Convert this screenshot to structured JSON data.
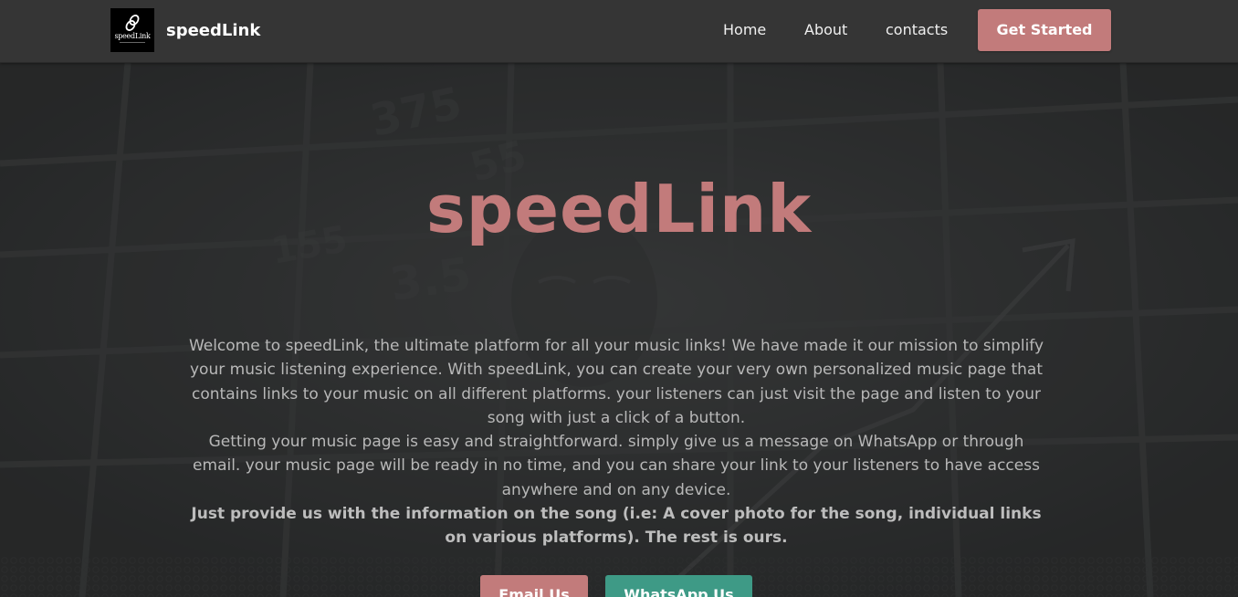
{
  "nav": {
    "brand": "speedLink",
    "logo_text": "speedLink",
    "links": [
      "Home",
      "About",
      "contacts"
    ],
    "cta": "Get Started"
  },
  "hero": {
    "title": "speedLink",
    "paragraph1": "Welcome to speedLink, the ultimate platform for all your music links! We have made it our mission to simplify your music listening experience. With speedLink, you can create your very own personalized music page that contains links to your music on all different platforms. your listeners can just visit the page and listen to your song with just a  click of a button.",
    "paragraph2": "Getting your music page is easy and straightforward. simply give us a message on WhatsApp or through email. your music page will be ready in no time, and you can share your link to your listeners to have access anywhere and on any device.",
    "paragraph3": "Just provide us with the information on the song (i.e: A cover photo for the song, individual links on various platforms). The rest is ours.",
    "buttons": {
      "email": "Email Us",
      "whatsapp": "WhatsApp Us"
    }
  },
  "colors": {
    "accent": "#c27b7b",
    "whatsapp": "#3e9a86",
    "navbar": "#353535"
  },
  "icons": [
    "link-icon"
  ]
}
